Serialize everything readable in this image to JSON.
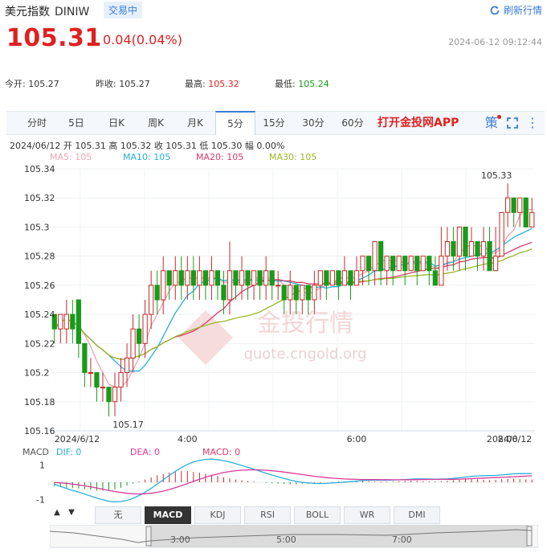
{
  "header": {
    "name": "美元指数",
    "code": "DINIW",
    "status": "交易中",
    "refresh_label": "刷新行情",
    "price": "105.31",
    "change": "0.04(0.04%)",
    "timestamp": "2024-06-12 09:12:44"
  },
  "quote": {
    "open_label": "今开:",
    "open": "105.27",
    "prev_label": "昨收:",
    "prev": "105.27",
    "high_label": "最高:",
    "high": "105.32",
    "low_label": "最低:",
    "low": "105.24"
  },
  "tabs": [
    "分时",
    "5日",
    "日K",
    "周K",
    "月K",
    "5分",
    "15分",
    "30分",
    "60分"
  ],
  "active_tab": "5分",
  "app_link": "打开金投网APP",
  "ohlc": "2024/06/12  开 105.31  高 105.32  收 105.31  低 105.30  幅 0.00%",
  "ma_labels": {
    "ma5": "MA5: 105",
    "ma10": "MA10: 105",
    "ma20": "MA20: 105",
    "ma30": "MA30: 105"
  },
  "colors": {
    "up": "#c62828",
    "down": "#1a9a1a",
    "ma5": "#f0a3b6",
    "ma10": "#29b0d8",
    "ma20": "#d83a6a",
    "ma30": "#9ab82a",
    "accent": "#3b7dd8"
  },
  "watermark": {
    "brand": "金投行情",
    "url": "quote.cngold.org"
  },
  "chart_data": [
    {
      "type": "candlestick",
      "x_ticks": [
        "2024/6/12",
        "4:00",
        "6:00",
        "8:00",
        "2024/6/12"
      ],
      "y_ticks": [
        "105.34",
        "105.32",
        "105.3",
        "105.28",
        "105.26",
        "105.24",
        "105.22",
        "105.2",
        "105.18",
        "105.16"
      ],
      "ylim": [
        105.16,
        105.34
      ],
      "annotations": {
        "max": "105.33",
        "min": "105.17"
      },
      "candles": [
        [
          105.24,
          105.23,
          105.24,
          105.22
        ],
        [
          105.23,
          105.24,
          105.24,
          105.22
        ],
        [
          105.23,
          105.24,
          105.25,
          105.22
        ],
        [
          105.24,
          105.23,
          105.25,
          105.22
        ],
        [
          105.25,
          105.22,
          105.25,
          105.21
        ],
        [
          105.22,
          105.2,
          105.22,
          105.19
        ],
        [
          105.2,
          105.2,
          105.21,
          105.19
        ],
        [
          105.2,
          105.19,
          105.2,
          105.18
        ],
        [
          105.19,
          105.19,
          105.2,
          105.18
        ],
        [
          105.19,
          105.18,
          105.19,
          105.17
        ],
        [
          105.18,
          105.19,
          105.2,
          105.17
        ],
        [
          105.19,
          105.2,
          105.21,
          105.18
        ],
        [
          105.2,
          105.21,
          105.22,
          105.19
        ],
        [
          105.21,
          105.23,
          105.24,
          105.2
        ],
        [
          105.23,
          105.22,
          105.24,
          105.21
        ],
        [
          105.22,
          105.24,
          105.25,
          105.21
        ],
        [
          105.24,
          105.26,
          105.27,
          105.23
        ],
        [
          105.26,
          105.25,
          105.27,
          105.24
        ],
        [
          105.25,
          105.27,
          105.28,
          105.24
        ],
        [
          105.27,
          105.26,
          105.27,
          105.25
        ],
        [
          105.26,
          105.27,
          105.28,
          105.25
        ],
        [
          105.27,
          105.26,
          105.28,
          105.25
        ],
        [
          105.26,
          105.27,
          105.28,
          105.25
        ],
        [
          105.27,
          105.26,
          105.28,
          105.25
        ],
        [
          105.26,
          105.27,
          105.28,
          105.25
        ],
        [
          105.27,
          105.26,
          105.27,
          105.25
        ],
        [
          105.26,
          105.27,
          105.28,
          105.25
        ],
        [
          105.27,
          105.26,
          105.27,
          105.25
        ],
        [
          105.26,
          105.25,
          105.27,
          105.24
        ],
        [
          105.25,
          105.27,
          105.29,
          105.24
        ],
        [
          105.27,
          105.26,
          105.27,
          105.25
        ],
        [
          105.26,
          105.27,
          105.28,
          105.25
        ],
        [
          105.27,
          105.26,
          105.27,
          105.25
        ],
        [
          105.26,
          105.27,
          105.27,
          105.25
        ],
        [
          105.27,
          105.26,
          105.27,
          105.25
        ],
        [
          105.26,
          105.27,
          105.28,
          105.25
        ],
        [
          105.27,
          105.26,
          105.27,
          105.25
        ],
        [
          105.26,
          105.26,
          105.27,
          105.25
        ],
        [
          105.26,
          105.25,
          105.26,
          105.24
        ],
        [
          105.25,
          105.26,
          105.27,
          105.24
        ],
        [
          105.26,
          105.25,
          105.26,
          105.24
        ],
        [
          105.25,
          105.26,
          105.26,
          105.24
        ],
        [
          105.26,
          105.25,
          105.26,
          105.24
        ],
        [
          105.25,
          105.26,
          105.27,
          105.24
        ],
        [
          105.26,
          105.27,
          105.27,
          105.25
        ],
        [
          105.27,
          105.26,
          105.27,
          105.25
        ],
        [
          105.26,
          105.27,
          105.27,
          105.26
        ],
        [
          105.27,
          105.26,
          105.27,
          105.25
        ],
        [
          105.26,
          105.27,
          105.28,
          105.26
        ],
        [
          105.27,
          105.26,
          105.27,
          105.25
        ],
        [
          105.26,
          105.27,
          105.28,
          105.26
        ],
        [
          105.27,
          105.28,
          105.28,
          105.26
        ],
        [
          105.28,
          105.27,
          105.28,
          105.26
        ],
        [
          105.27,
          105.29,
          105.29,
          105.26
        ],
        [
          105.29,
          105.27,
          105.29,
          105.26
        ],
        [
          105.27,
          105.28,
          105.28,
          105.26
        ],
        [
          105.28,
          105.27,
          105.28,
          105.26
        ],
        [
          105.27,
          105.28,
          105.28,
          105.27
        ],
        [
          105.28,
          105.27,
          105.28,
          105.26
        ],
        [
          105.27,
          105.28,
          105.28,
          105.27
        ],
        [
          105.28,
          105.27,
          105.28,
          105.26
        ],
        [
          105.27,
          105.28,
          105.28,
          105.27
        ],
        [
          105.28,
          105.27,
          105.28,
          105.26
        ],
        [
          105.27,
          105.26,
          105.28,
          105.26
        ],
        [
          105.26,
          105.28,
          105.3,
          105.26
        ],
        [
          105.28,
          105.29,
          105.3,
          105.27
        ],
        [
          105.29,
          105.28,
          105.3,
          105.27
        ],
        [
          105.28,
          105.3,
          105.3,
          105.27
        ],
        [
          105.3,
          105.28,
          105.3,
          105.27
        ],
        [
          105.28,
          105.29,
          105.3,
          105.28
        ],
        [
          105.29,
          105.28,
          105.29,
          105.27
        ],
        [
          105.28,
          105.29,
          105.3,
          105.27
        ],
        [
          105.29,
          105.27,
          105.3,
          105.27
        ],
        [
          105.27,
          105.28,
          105.3,
          105.27
        ],
        [
          105.28,
          105.31,
          105.31,
          105.28
        ],
        [
          105.31,
          105.32,
          105.33,
          105.3
        ],
        [
          105.32,
          105.31,
          105.32,
          105.3
        ],
        [
          105.31,
          105.32,
          105.32,
          105.3
        ],
        [
          105.32,
          105.3,
          105.32,
          105.3
        ],
        [
          105.3,
          105.31,
          105.32,
          105.3
        ]
      ]
    },
    {
      "type": "bar",
      "title": "MACD",
      "series_labels": {
        "dif": "DIF: 0",
        "dea": "DEA: 0",
        "macd": "MACD: 0"
      },
      "y_ticks": [
        "1",
        "-1"
      ],
      "ylim": [
        -1.3,
        1.3
      ],
      "macd_values": [
        -0.3,
        -0.35,
        -0.4,
        -0.42,
        -0.45,
        -0.5,
        -0.55,
        -0.6,
        -0.62,
        -0.6,
        -0.5,
        -0.4,
        -0.25,
        -0.1,
        0.05,
        0.2,
        0.35,
        0.5,
        0.6,
        0.7,
        0.75,
        0.8,
        0.8,
        0.75,
        0.7,
        0.62,
        0.55,
        0.45,
        0.35,
        0.28,
        0.2,
        0.15,
        0.1,
        0.05,
        0.0,
        -0.05,
        -0.08,
        -0.1,
        -0.12,
        -0.15,
        -0.15,
        -0.12,
        -0.1,
        -0.08,
        -0.05,
        0.0,
        0.03,
        0.05,
        0.06,
        0.08,
        0.1,
        0.1,
        0.08,
        0.06,
        0.05,
        0.05,
        0.06,
        0.08,
        0.1,
        0.12,
        0.1,
        0.08,
        0.06,
        0.05,
        0.08,
        0.1,
        0.15,
        0.18,
        0.2,
        0.22,
        0.2,
        0.18,
        0.15,
        0.18,
        0.22,
        0.25,
        0.25,
        0.22,
        0.2,
        0.2
      ]
    }
  ],
  "indicator_tabs": [
    "无",
    "MACD",
    "KDJ",
    "RSI",
    "BOLL",
    "WR",
    "DMI"
  ],
  "active_indicator": "MACD",
  "navigator_ticks": [
    "3:00",
    "5:00",
    "7:00"
  ]
}
